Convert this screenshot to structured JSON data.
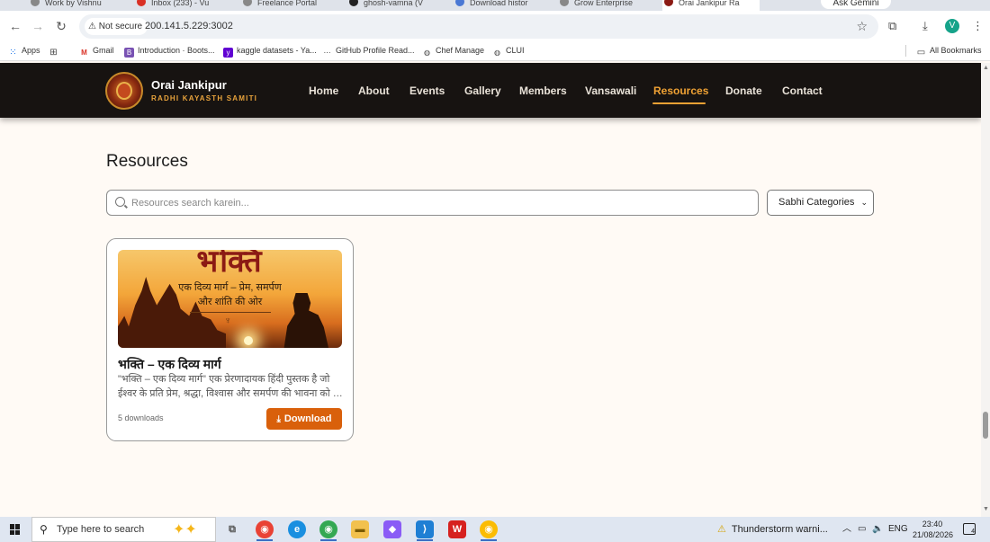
{
  "browser": {
    "tabs": [
      {
        "title": "Work by Vishnu",
        "active": false
      },
      {
        "title": "Inbox (233) - Vu",
        "active": false
      },
      {
        "title": "Freelance Portal",
        "active": false
      },
      {
        "title": "ghosh-vamna (V",
        "active": false
      },
      {
        "title": "Download histor",
        "active": false
      },
      {
        "title": "Grow Enterprise",
        "active": false
      },
      {
        "title": "Orai Jankipur Ra",
        "active": true
      }
    ],
    "gemini_label": "Ask Gemini",
    "not_secure_label": "Not secure",
    "url": "200.141.5.229:3002",
    "avatar_letter": "V",
    "bookmarks": [
      {
        "label": "Apps",
        "icon": "apps-grid-icon"
      },
      {
        "label": "",
        "icon": "grid-icon"
      },
      {
        "label": "Gmail",
        "icon": "gmail-icon"
      },
      {
        "label": "Introduction · Boots...",
        "icon": "bootstrap-icon"
      },
      {
        "label": "kaggle datasets - Ya...",
        "icon": "yahoo-icon"
      },
      {
        "label": "GitHub Profile Read...",
        "icon": "dev-icon"
      },
      {
        "label": "Chef Manage",
        "icon": "globe-icon"
      },
      {
        "label": "CLUI",
        "icon": "globe-icon"
      }
    ],
    "all_bookmarks_label": "All Bookmarks"
  },
  "site": {
    "brand_name": "Orai Jankipur",
    "brand_sub": "RADHI KAYASTH SAMITI",
    "nav": [
      {
        "label": "Home",
        "active": false
      },
      {
        "label": "About",
        "active": false
      },
      {
        "label": "Events",
        "active": false
      },
      {
        "label": "Gallery",
        "active": false
      },
      {
        "label": "Members",
        "active": false
      },
      {
        "label": "Vansawali",
        "active": false
      },
      {
        "label": "Resources",
        "active": true
      },
      {
        "label": "Donate",
        "active": false
      },
      {
        "label": "Contact",
        "active": false
      }
    ]
  },
  "main": {
    "title": "Resources",
    "search_placeholder": "Resources search karein...",
    "category_selected": "Sabhi Categories",
    "cards": [
      {
        "thumb_big": "भक्ति",
        "thumb_line1": "एक दिव्य मार्ग – प्रेम, समर्पण",
        "thumb_line2": "और शांति की ओर",
        "title": "भक्ति – एक दिव्य मार्ग",
        "desc_line1": "\"भक्ति – एक दिव्य मार्ग\" एक प्रेरणादायक हिंदी पुस्तक है जो",
        "desc_line2": "ईश्वर के प्रति प्रेम, श्रद्धा, विश्वास और समर्पण की भावना को सर...",
        "downloads": "5 downloads",
        "button_label": "Download"
      }
    ]
  },
  "taskbar": {
    "search_placeholder": "Type here to search",
    "weather": "Thunderstorm warni...",
    "lang": "ENG",
    "time": "23:40",
    "date": "21/08/2026",
    "notif_count": "4"
  },
  "colors": {
    "accent": "#f0a234",
    "download_button": "#d9600b",
    "header_bg": "#171311"
  }
}
